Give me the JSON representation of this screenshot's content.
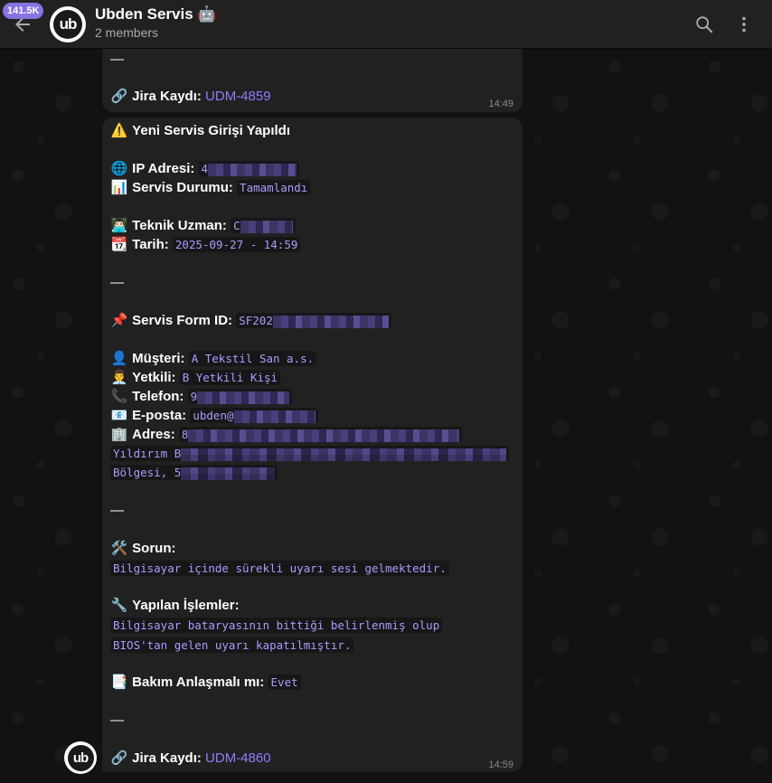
{
  "header": {
    "unread_count": "141.5K",
    "avatar_text": "ub",
    "title": "Ubden Servis 🤖",
    "subtitle": "2 members"
  },
  "message1": {
    "divider": "—",
    "jira_label": "Jira Kaydı:",
    "jira_link": "UDM-4859",
    "time": "14:49"
  },
  "message2": {
    "heading": "Yeni Servis Girişi Yapıldı",
    "ip_label": "IP Adresi:",
    "ip_value": "4",
    "status_label": "Servis Durumu:",
    "status_value": "Tamamlandı",
    "tech_label": "Teknik Uzman:",
    "tech_value": "C",
    "date_label": "Tarih:",
    "date_value": "2025-09-27 - 14:59",
    "divider1": "—",
    "form_label": "Servis Form ID:",
    "form_value": "SF202",
    "customer_label": "Müşteri:",
    "customer_value": "A Tekstil San a.s.",
    "contact_label": "Yetkili:",
    "contact_value": "B Yetkili Kişi",
    "phone_label": "Telefon:",
    "phone_value": "9",
    "email_label": "E-posta:",
    "email_value": "ubden@",
    "address_label": "Adres:",
    "address_line1": "8",
    "address_line2": "Yıldırım B",
    "address_line3": "Bölgesi, 5",
    "divider2": "—",
    "problem_label": "Sorun:",
    "problem_value": "Bilgisayar içinde sürekli uyarı sesi gelmektedir.",
    "actions_label": "Yapılan İşlemler:",
    "actions_line1": "Bilgisayar bataryasının bittiği belirlenmiş olup ",
    "actions_line2": "BIOS'tan gelen uyarı kapatılmıştır.",
    "maintenance_label": "Bakım Anlaşmalı mı:",
    "maintenance_value": "Evet",
    "divider3": "—",
    "jira_label": "Jira Kaydı:",
    "jira_link": "UDM-4860",
    "time": "14:59"
  },
  "sender": {
    "avatar_text": "ub"
  },
  "icons": {
    "link": "🔗",
    "warning": "⚠️",
    "globe": "🌐",
    "chart": "📊",
    "technician": "👨🏻‍💻",
    "calendar": "📆",
    "pushpin": "📌",
    "person": "👤",
    "contact": "👨‍💼",
    "phone": "📞",
    "email": "📧",
    "office": "🏢",
    "tools": "🛠️",
    "wrench": "🔧",
    "document": "📑"
  },
  "colors": {
    "accent": "#8774e1",
    "link": "#8f7dfb",
    "code": "#a99cff",
    "bubble": "#212121"
  }
}
